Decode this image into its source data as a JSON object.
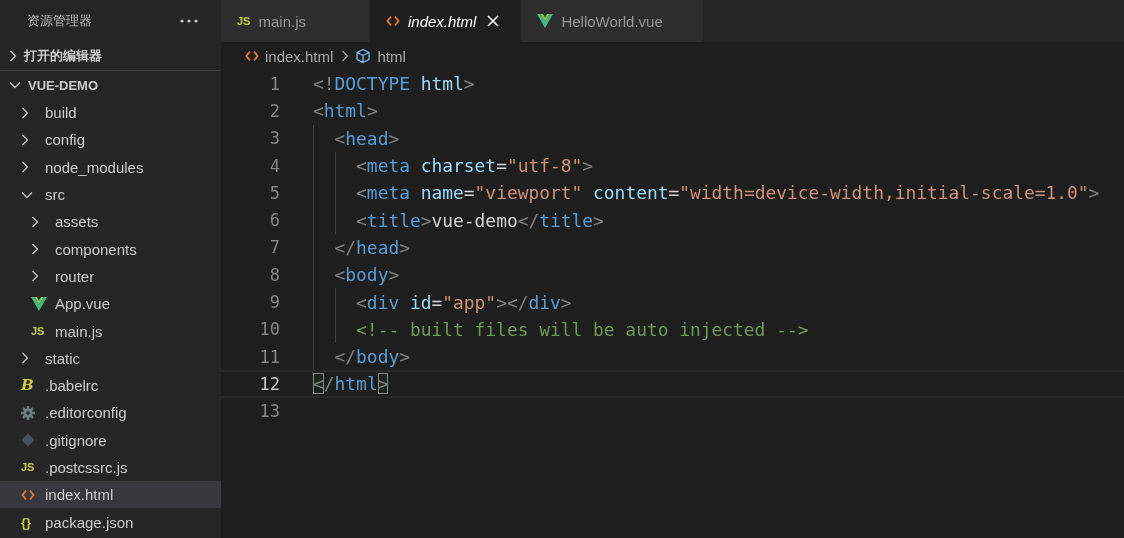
{
  "sidebar": {
    "title": "资源管理器",
    "sections": [
      {
        "title": "打开的编辑器",
        "expanded": false
      },
      {
        "title": "VUE-DEMO",
        "expanded": true,
        "items": [
          {
            "name": "build",
            "kind": "folder",
            "expanded": false,
            "selected": false
          },
          {
            "name": "config",
            "kind": "folder",
            "expanded": false,
            "selected": false
          },
          {
            "name": "node_modules",
            "kind": "folder",
            "expanded": false,
            "selected": false
          },
          {
            "name": "src",
            "kind": "folder",
            "expanded": true,
            "selected": false,
            "children": [
              {
                "name": "assets",
                "kind": "folder",
                "expanded": false,
                "selected": false
              },
              {
                "name": "components",
                "kind": "folder",
                "expanded": false,
                "selected": false
              },
              {
                "name": "router",
                "kind": "folder",
                "expanded": false,
                "selected": false
              },
              {
                "name": "App.vue",
                "kind": "vue",
                "selected": false
              },
              {
                "name": "main.js",
                "kind": "js",
                "glyph": "JS",
                "selected": false
              }
            ]
          },
          {
            "name": "static",
            "kind": "folder",
            "expanded": false,
            "selected": false
          },
          {
            "name": ".babelrc",
            "kind": "babel",
            "glyph": "B",
            "selected": false
          },
          {
            "name": ".editorconfig",
            "kind": "gear",
            "selected": false
          },
          {
            "name": ".gitignore",
            "kind": "git",
            "selected": false
          },
          {
            "name": ".postcssrc.js",
            "kind": "js",
            "glyph": "JS",
            "selected": false
          },
          {
            "name": "index.html",
            "kind": "html",
            "selected": true
          },
          {
            "name": "package.json",
            "kind": "json",
            "glyph": "{}",
            "selected": false
          }
        ]
      }
    ]
  },
  "tabs": [
    {
      "label": "main.js",
      "kind": "js",
      "glyph": "JS",
      "selected": false,
      "preview": false
    },
    {
      "label": "index.html",
      "kind": "html",
      "selected": true,
      "preview": true
    },
    {
      "label": "HelloWorld.vue",
      "kind": "vue",
      "selected": false,
      "preview": false
    }
  ],
  "breadcrumbs": [
    {
      "label": "index.html",
      "kind": "html"
    },
    {
      "label": "html",
      "kind": "element"
    }
  ],
  "code": {
    "lines": [
      {
        "number": "1",
        "current": false,
        "tokens": [
          {
            "kind": "punct",
            "text": "<!"
          },
          {
            "kind": "tag",
            "text": "DOCTYPE "
          },
          {
            "kind": "attr",
            "text": "html"
          },
          {
            "kind": "punct",
            "text": ">"
          }
        ]
      },
      {
        "number": "2",
        "current": false,
        "tokens": [
          {
            "kind": "punct",
            "text": "<"
          },
          {
            "kind": "tag",
            "text": "html"
          },
          {
            "kind": "punct",
            "text": ">"
          }
        ]
      },
      {
        "number": "3",
        "current": false,
        "tokens": [
          {
            "kind": "punct",
            "text": "  <"
          },
          {
            "kind": "tag",
            "text": "head"
          },
          {
            "kind": "punct",
            "text": ">"
          }
        ]
      },
      {
        "number": "4",
        "current": false,
        "tokens": [
          {
            "kind": "punct",
            "text": "    <"
          },
          {
            "kind": "tag",
            "text": "meta "
          },
          {
            "kind": "attr",
            "text": "charset"
          },
          {
            "kind": "text",
            "text": "="
          },
          {
            "kind": "string",
            "text": "\"utf-8\""
          },
          {
            "kind": "punct",
            "text": ">"
          }
        ]
      },
      {
        "number": "5",
        "current": false,
        "tokens": [
          {
            "kind": "punct",
            "text": "    <"
          },
          {
            "kind": "tag",
            "text": "meta "
          },
          {
            "kind": "attr",
            "text": "name"
          },
          {
            "kind": "text",
            "text": "="
          },
          {
            "kind": "string",
            "text": "\"viewport\" "
          },
          {
            "kind": "attr",
            "text": "content"
          },
          {
            "kind": "text",
            "text": "="
          },
          {
            "kind": "string",
            "text": "\"width=device-width,initial-scale=1.0\""
          },
          {
            "kind": "punct",
            "text": ">"
          }
        ]
      },
      {
        "number": "6",
        "current": false,
        "tokens": [
          {
            "kind": "punct",
            "text": "    <"
          },
          {
            "kind": "tag",
            "text": "title"
          },
          {
            "kind": "punct",
            "text": ">"
          },
          {
            "kind": "text",
            "text": "vue-demo"
          },
          {
            "kind": "punct",
            "text": "</"
          },
          {
            "kind": "tag",
            "text": "title"
          },
          {
            "kind": "punct",
            "text": ">"
          }
        ]
      },
      {
        "number": "7",
        "current": false,
        "tokens": [
          {
            "kind": "punct",
            "text": "  </"
          },
          {
            "kind": "tag",
            "text": "head"
          },
          {
            "kind": "punct",
            "text": ">"
          }
        ]
      },
      {
        "number": "8",
        "current": false,
        "tokens": [
          {
            "kind": "punct",
            "text": "  <"
          },
          {
            "kind": "tag",
            "text": "body"
          },
          {
            "kind": "punct",
            "text": ">"
          }
        ]
      },
      {
        "number": "9",
        "current": false,
        "tokens": [
          {
            "kind": "punct",
            "text": "    <"
          },
          {
            "kind": "tag",
            "text": "div "
          },
          {
            "kind": "attr",
            "text": "id"
          },
          {
            "kind": "text",
            "text": "="
          },
          {
            "kind": "string",
            "text": "\"app\""
          },
          {
            "kind": "punct",
            "text": "></"
          },
          {
            "kind": "tag",
            "text": "div"
          },
          {
            "kind": "punct",
            "text": ">"
          }
        ]
      },
      {
        "number": "10",
        "current": false,
        "tokens": [
          {
            "kind": "comment",
            "text": "    <!-- built files will be auto injected -->"
          }
        ]
      },
      {
        "number": "11",
        "current": false,
        "tokens": [
          {
            "kind": "punct",
            "text": "  </"
          },
          {
            "kind": "tag",
            "text": "body"
          },
          {
            "kind": "punct",
            "text": ">"
          }
        ]
      },
      {
        "number": "12",
        "current": true,
        "tokens": [
          {
            "kind": "punct",
            "text": "<",
            "matched": true
          },
          {
            "kind": "punct",
            "text": "/"
          },
          {
            "kind": "tag",
            "text": "html"
          },
          {
            "kind": "punct",
            "text": ">",
            "matched": true
          }
        ]
      },
      {
        "number": "13",
        "current": false
      }
    ]
  }
}
